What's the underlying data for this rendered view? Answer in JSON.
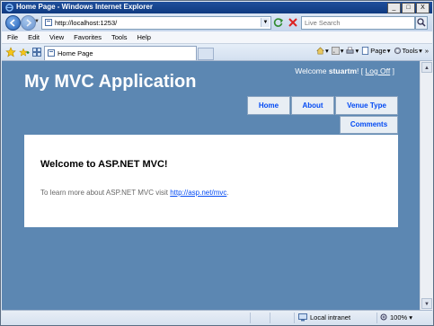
{
  "window": {
    "title": "Home Page - Windows Internet Explorer",
    "buttons": [
      "_",
      "□",
      "X"
    ]
  },
  "address_bar": {
    "url": "http://localhost:1253/",
    "search_placeholder": "Live Search"
  },
  "menu": [
    "File",
    "Edit",
    "View",
    "Favorites",
    "Tools",
    "Help"
  ],
  "tab": {
    "label": "Home Page"
  },
  "command_bar": {
    "page_label": "Page",
    "tools_label": "Tools"
  },
  "site": {
    "title": "My MVC Application",
    "welcome": "Welcome",
    "user": "stuartm",
    "bang": "! [",
    "logoff": "Log Off",
    "close_bracket": "]",
    "nav": [
      "Home",
      "About",
      "Venue Type",
      "Comments"
    ],
    "heading": "Welcome to ASP.NET MVC!",
    "intro": "To learn more about ASP.NET MVC visit ",
    "link": "http://asp.net/mvc",
    "period": "."
  },
  "status": {
    "zone": "Local intranet",
    "zoom": "100%"
  },
  "colors": {
    "page_bg": "#5c87b2",
    "nav_link": "#034af3",
    "title_bar": "#1f4f9c"
  }
}
